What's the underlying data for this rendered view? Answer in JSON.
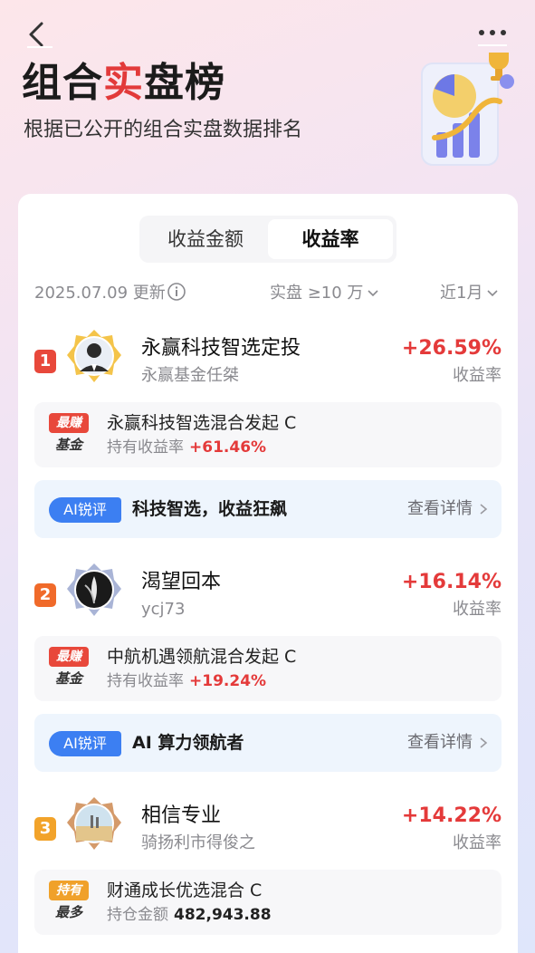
{
  "nav": {
    "back_icon": "back-arrow-icon",
    "more_icon": "more-dots-icon"
  },
  "header": {
    "title_part1": "组合",
    "title_part2": "实",
    "title_part3": "盘榜",
    "subtitle": "根据已公开的组合实盘数据排名"
  },
  "tabs": [
    {
      "label": "收益金额",
      "active": false
    },
    {
      "label": "收益率",
      "active": true
    }
  ],
  "filters": {
    "updated": "2025.07.09 更新",
    "asset_filter": "实盘 ≥10 万",
    "period_filter": "近1月"
  },
  "entries": [
    {
      "rank": "1",
      "name": "永赢科技智选定投",
      "owner": "永赢基金任桀",
      "rate": "+26.59%",
      "rate_label": "收益率",
      "badge_top": "最赚",
      "badge_bottom": "基金",
      "fund_name": "永赢科技智选混合发起 C",
      "fund_metric_label": "持有收益率",
      "fund_metric_value": "+61.46%",
      "ai_badge": "AI锐评",
      "ai_text": "科技智选，收益狂飙",
      "ai_link": "查看详情"
    },
    {
      "rank": "2",
      "name": "渴望回本",
      "owner": "ycj73",
      "rate": "+16.14%",
      "rate_label": "收益率",
      "badge_top": "最赚",
      "badge_bottom": "基金",
      "fund_name": "中航机遇领航混合发起 C",
      "fund_metric_label": "持有收益率",
      "fund_metric_value": "+19.24%",
      "ai_badge": "AI锐评",
      "ai_text": "AI 算力领航者",
      "ai_link": "查看详情"
    },
    {
      "rank": "3",
      "name": "相信专业",
      "owner": "骑扬利市得俊之",
      "rate": "+14.22%",
      "rate_label": "收益率",
      "badge_top": "持有",
      "badge_bottom": "最多",
      "fund_name": "财通成长优选混合 C",
      "fund_metric_label": "持仓金额",
      "fund_metric_value": "482,943.88"
    }
  ],
  "colors": {
    "accent_red": "#e43a3a",
    "ai_blue": "#3c7ff2",
    "rank1": "#e8483b",
    "rank2": "#f06a2a",
    "rank3": "#f2a32a"
  }
}
